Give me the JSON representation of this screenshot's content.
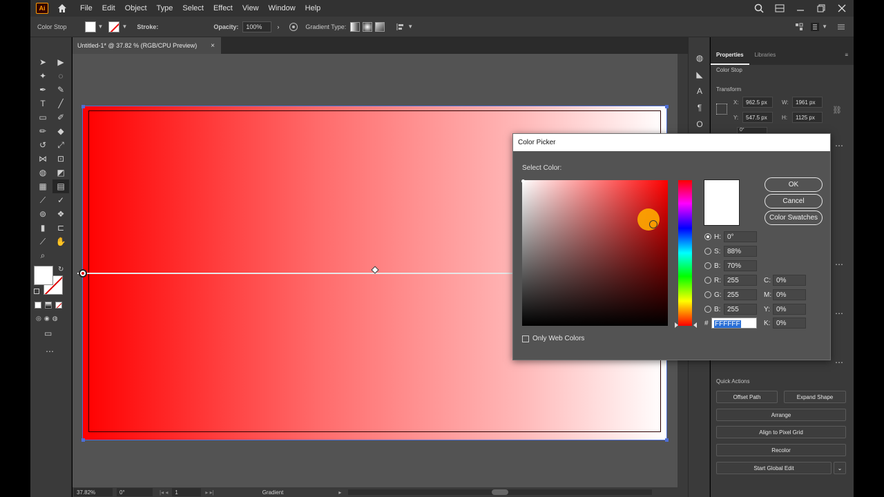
{
  "menubar": {
    "logo": "Ai",
    "items": [
      "File",
      "Edit",
      "Object",
      "Type",
      "Select",
      "Effect",
      "View",
      "Window",
      "Help"
    ]
  },
  "control": {
    "mode_label": "Color Stop",
    "stroke_label": "Stroke:",
    "opacity_label": "Opacity:",
    "opacity_value": "100%",
    "gradient_type_label": "Gradient Type:"
  },
  "document": {
    "tab_title": "Untitled-1* @ 37.82 % (RGB/CPU Preview)",
    "close_glyph": "×"
  },
  "status": {
    "zoom": "37.82%",
    "rotation": "0°",
    "artboard": "1",
    "tool_name": "Gradient"
  },
  "properties": {
    "tabs": [
      "Properties",
      "Libraries"
    ],
    "section": "Color Stop",
    "transform_label": "Transform",
    "x_label": "X:",
    "x_value": "962.5 px",
    "y_label": "Y:",
    "y_value": "547.5 px",
    "w_label": "W:",
    "w_value": "1961 px",
    "h_label": "H:",
    "h_value": "1125 px",
    "angle_value": "0°",
    "quick_actions_label": "Quick Actions",
    "buttons": {
      "offset_path": "Offset Path",
      "expand_shape": "Expand Shape",
      "arrange": "Arrange",
      "align_pixel": "Align to Pixel Grid",
      "recolor": "Recolor",
      "global_edit": "Start Global Edit"
    }
  },
  "color_picker": {
    "title": "Color Picker",
    "select_color_label": "Select Color:",
    "ok": "OK",
    "cancel": "Cancel",
    "swatches": "Color Swatches",
    "h_label": "H:",
    "h": "0°",
    "s_label": "S:",
    "s": "88%",
    "b_label": "B:",
    "b": "70%",
    "r_label": "R:",
    "r": "255",
    "g_label": "G:",
    "g": "255",
    "bb_label": "B:",
    "bb": "255",
    "c_label": "C:",
    "c": "0%",
    "m_label": "M:",
    "m": "0%",
    "yy_label": "Y:",
    "yy": "0%",
    "k_label": "K:",
    "k": "0%",
    "hash": "#",
    "hex": "FFFFFF",
    "web_only_label": "Only Web Colors",
    "selected_hex": "#FFFFFF"
  },
  "colors": {
    "gradient_start": "#ff0000",
    "gradient_end": "#ffffff",
    "accent": "#ff9a00"
  }
}
